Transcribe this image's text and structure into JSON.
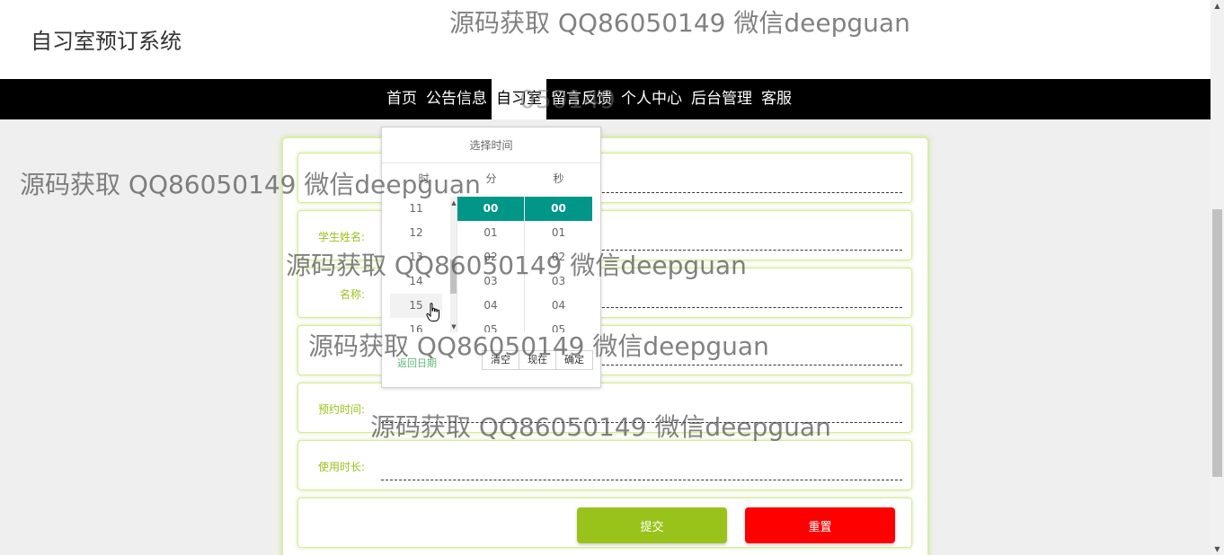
{
  "header": {
    "site_title": "自习室预订系统"
  },
  "nav": {
    "items": [
      {
        "label": "首页",
        "active": false
      },
      {
        "label": "公告信息",
        "active": false
      },
      {
        "label": "自习室",
        "active": true
      },
      {
        "label": "留言反馈",
        "active": false
      },
      {
        "label": "个人中心",
        "active": false
      },
      {
        "label": "后台管理",
        "active": false
      },
      {
        "label": "客服",
        "active": false
      }
    ]
  },
  "form": {
    "fields": [
      {
        "label": "",
        "value": "",
        "placeholder": ""
      },
      {
        "label": "学生姓名:",
        "value": "",
        "placeholder": ""
      },
      {
        "label": "名称:",
        "value": "",
        "placeholder": ""
      },
      {
        "label": "",
        "value": "",
        "placeholder": ""
      },
      {
        "label": "预约时间:",
        "value": "",
        "placeholder": ""
      },
      {
        "label": "使用时长:",
        "value": "",
        "placeholder": ""
      }
    ],
    "submit_label": "提交",
    "reset_label": "重置"
  },
  "time_picker": {
    "title": "选择时间",
    "headers": {
      "hour": "时",
      "minute": "分",
      "second": "秒"
    },
    "hours": [
      "11",
      "12",
      "13",
      "14",
      "15",
      "16"
    ],
    "minutes": [
      "00",
      "01",
      "02",
      "03",
      "04",
      "05"
    ],
    "seconds": [
      "00",
      "01",
      "02",
      "03",
      "04",
      "05"
    ],
    "selected_minute": "00",
    "selected_second": "00",
    "hover_hour": "15",
    "back_to_date": "返回日期",
    "clear_label": "清空",
    "now_label": "现在",
    "confirm_label": "确定"
  },
  "watermark": {
    "text": "源码获取 QQ86050149 微信deepguan",
    "partial_text": "050149"
  },
  "colors": {
    "accent_green": "#99c21a",
    "picker_selected": "#009688",
    "reset_red": "#ff0000",
    "nav_bg": "#000000"
  },
  "icons": {
    "cursor": "hand-pointer-icon",
    "scroll_up": "triangle-up-icon",
    "scroll_down": "triangle-down-icon"
  }
}
